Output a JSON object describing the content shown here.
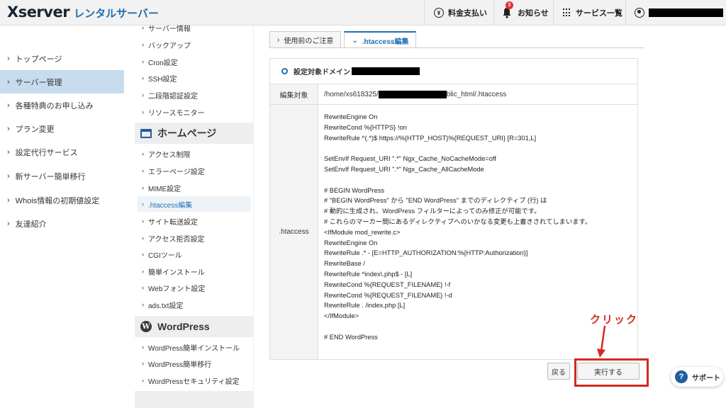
{
  "header": {
    "logo_main": "Xserver",
    "logo_sub": "レンタルサーバー",
    "payment": "料金支払い",
    "notifications": "お知らせ",
    "notification_count": "3",
    "services": "サービス一覧"
  },
  "leftnav": {
    "items": [
      {
        "label": "トップページ"
      },
      {
        "label": "サーバー管理"
      },
      {
        "label": "各種特典のお申し込み"
      },
      {
        "label": "プラン変更"
      },
      {
        "label": "設定代行サービス"
      },
      {
        "label": "新サーバー簡単移行"
      },
      {
        "label": "Whois情報の初期値設定"
      },
      {
        "label": "友達紹介"
      }
    ]
  },
  "subnav": {
    "server_items": [
      {
        "label": "サーバー情報"
      },
      {
        "label": "バックアップ"
      },
      {
        "label": "Cron設定"
      },
      {
        "label": "SSH設定"
      },
      {
        "label": "二段階認証設定"
      },
      {
        "label": "リソースモニター"
      }
    ],
    "homepage_heading": "ホームページ",
    "homepage_items": [
      {
        "label": "アクセス制限"
      },
      {
        "label": "エラーページ設定"
      },
      {
        "label": "MIME設定"
      },
      {
        "label": ".htaccess編集"
      },
      {
        "label": "サイト転送設定"
      },
      {
        "label": "アクセス拒否設定"
      },
      {
        "label": "CGIツール"
      },
      {
        "label": "簡単インストール"
      },
      {
        "label": "Webフォント設定"
      },
      {
        "label": "ads.txt設定"
      }
    ],
    "wordpress_heading": "WordPress",
    "wordpress_items": [
      {
        "label": "WordPress簡単インストール"
      },
      {
        "label": "WordPress簡単移行"
      },
      {
        "label": "WordPressセキュリティ設定"
      }
    ]
  },
  "tabs": [
    {
      "label": "使用前のご注意"
    },
    {
      "label": ".htaccess編集"
    }
  ],
  "panel": {
    "domain_label": "設定対象ドメイン",
    "edit_target_label": "編集対象",
    "path_prefix": "/home/xs618325/",
    "path_suffix": "blic_html/.htaccess",
    "htaccess_label": ".htaccess",
    "code_lines": [
      "RewriteEngine On",
      "RewriteCond %{HTTPS} !on",
      "RewriteRule ^(.*)$ https://%{HTTP_HOST}%{REQUEST_URI} [R=301,L]",
      "",
      "SetEnvIf Request_URI \".*\" Ngx_Cache_NoCacheMode=off",
      "SetEnvIf Request_URI \".*\" Ngx_Cache_AllCacheMode",
      "",
      "# BEGIN WordPress",
      "# \"BEGIN WordPress\" から \"END WordPress\" までのディレクティブ (行) は",
      "# 動的に生成され、WordPress フィルターによってのみ修正が可能です。",
      "# これらのマーカー間にあるディレクティブへのいかなる変更も上書きされてしまいます。",
      "<IfModule mod_rewrite.c>",
      "RewriteEngine On",
      "RewriteRule .* - [E=HTTP_AUTHORIZATION:%{HTTP:Authorization}]",
      "RewriteBase /",
      "RewriteRule ^index\\.php$ - [L]",
      "RewriteCond %{REQUEST_FILENAME} !-f",
      "RewriteCond %{REQUEST_FILENAME} !-d",
      "RewriteRule . /index.php [L]",
      "</IfModule>",
      "",
      "# END WordPress"
    ]
  },
  "buttons": {
    "back": "戻る",
    "execute": "実行する"
  },
  "annotation": {
    "click": "クリック"
  },
  "support": {
    "label": "サポート"
  }
}
